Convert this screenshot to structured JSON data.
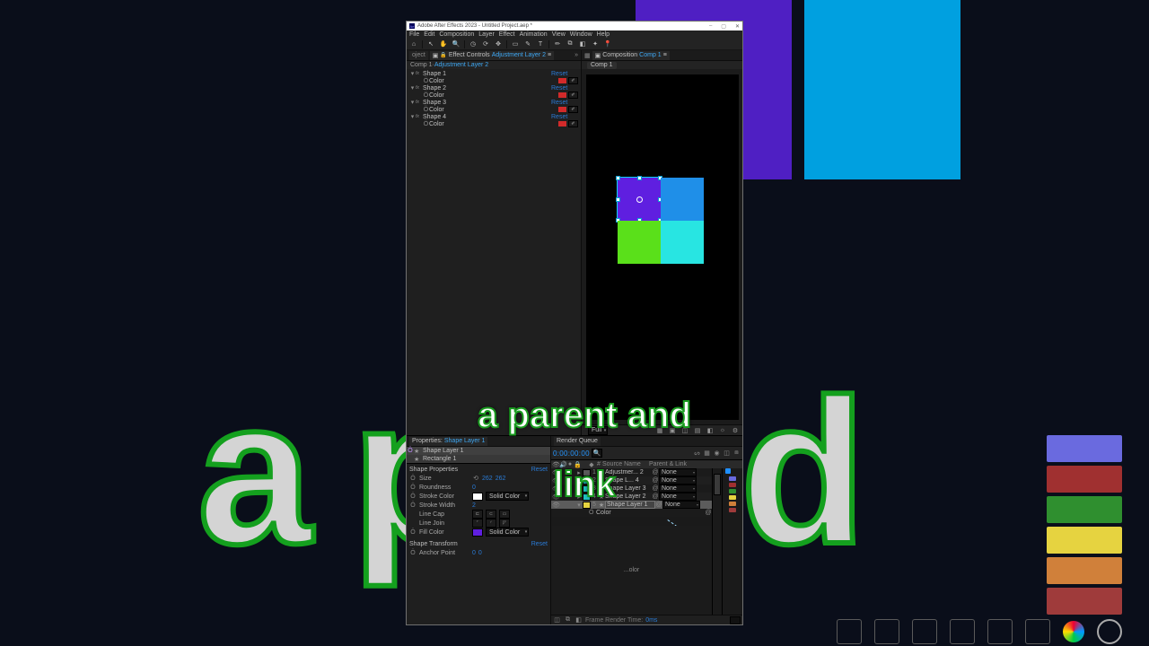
{
  "title": "Adobe After Effects 2023 - Untitled Project.aep *",
  "menu": [
    "File",
    "Edit",
    "Composition",
    "Layer",
    "Effect",
    "Animation",
    "View",
    "Window",
    "Help"
  ],
  "toolbar_icons": [
    "home",
    "selection",
    "hand",
    "zoom",
    "orbit",
    "rotate",
    "panbehind",
    "rect",
    "pen",
    "type",
    "brush",
    "clone",
    "eraser",
    "roto",
    "puppet",
    "pin"
  ],
  "left_panel": {
    "project_tab": "oject",
    "ec_tab_prefix": "Effect Controls",
    "ec_tab_ctx": "Adjustment Layer 2",
    "sub_comp": "Comp 1",
    "sub_layer": "Adjustment Layer 2",
    "effects": [
      {
        "name": "Shape 1",
        "param": "Color",
        "reset": "Reset",
        "swatch": "#d12a2a"
      },
      {
        "name": "Shape 2",
        "param": "Color",
        "reset": "Reset",
        "swatch": "#d12a2a"
      },
      {
        "name": "Shape 3",
        "param": "Color",
        "reset": "Reset",
        "swatch": "#d12a2a"
      },
      {
        "name": "Shape 4",
        "param": "Color",
        "reset": "Reset",
        "swatch": "#d12a2a"
      }
    ]
  },
  "comp_panel": {
    "tab_prefix": "Composition",
    "tab_ctx": "Comp 1",
    "breadcrumb": "Comp 1",
    "squares": {
      "tl": "#5f1fe0",
      "tr": "#1f8fe8",
      "bl": "#5ae01a",
      "br": "#28e5e2"
    },
    "caption_line1": "a parent and",
    "caption_line2": "link",
    "zoom": "",
    "resolution": "Full"
  },
  "props_panel": {
    "tab": "Properties:",
    "tab_ctx": "Shape Layer 1",
    "rows": [
      "Shape Layer 1",
      "Rectangle 1"
    ],
    "shape_properties_label": "Shape Properties",
    "shape_transform_label": "Shape Transform",
    "reset_label": "Reset",
    "props": {
      "size_label": "Size",
      "size_w": "262",
      "size_h": "262",
      "roundness_label": "Roundness",
      "roundness": "0",
      "stroke_color_label": "Stroke Color",
      "stroke_chip": "#ffffff",
      "stroke_mode": "Solid Color",
      "stroke_width_label": "Stroke Width",
      "stroke_width": "2",
      "line_cap_label": "Line Cap",
      "line_join_label": "Line Join",
      "fill_color_label": "Fill Color",
      "fill_chip": "#5f1fe0",
      "fill_mode": "Solid Color",
      "anchor_label": "Anchor Point",
      "anchor_x": "0",
      "anchor_y": "0"
    }
  },
  "timeline": {
    "tab": "Render Queue",
    "time": "0:00:00:00",
    "frame_desc": "",
    "cols": {
      "src": "Source Name",
      "parent": "Parent & Link"
    },
    "layers": [
      {
        "idx": "1",
        "label": "#5a5a5a",
        "name": "Adjustmer... 2",
        "parent": "None"
      },
      {
        "idx": "2",
        "label": "#20c4c4",
        "name": "Shape L... 4",
        "parent": "None"
      },
      {
        "idx": "3",
        "label": "#20c4c4",
        "name": "Shape Layer 3",
        "parent": "None"
      },
      {
        "idx": "4",
        "label": "#20c4c4",
        "name": "Shape Layer 2",
        "parent": "None"
      },
      {
        "idx": "5",
        "label": "#e6d340",
        "name": "Shape Layer 1",
        "parent": "None",
        "selected": true
      }
    ],
    "child_prop": "Color",
    "lower_hint": "...olor",
    "footer": {
      "label": "Frame Render Time:",
      "value": "0ms"
    },
    "mini_chips": [
      "#6a6adf",
      "#a03030",
      "#2f8f2f",
      "#e6d340",
      "#d0803a",
      "#9f3b3b"
    ]
  },
  "window_controls": {
    "min": "–",
    "max": "▢",
    "close": "✕"
  },
  "bg_text": "a p          and"
}
